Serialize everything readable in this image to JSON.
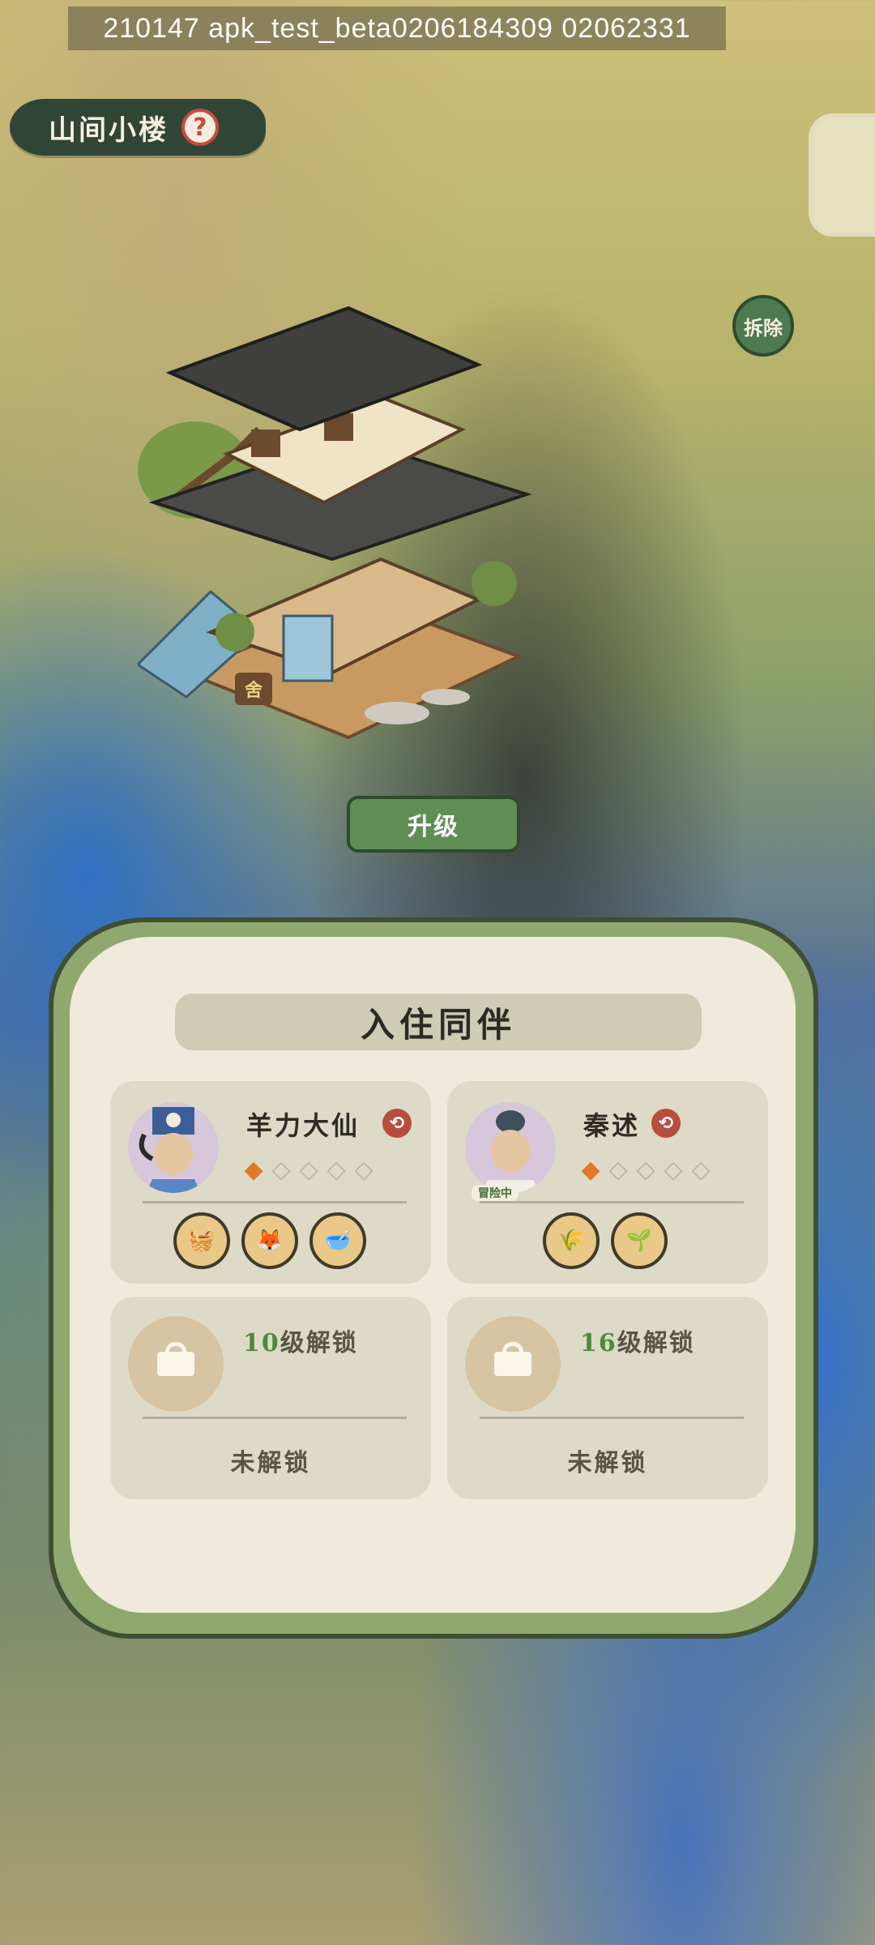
{
  "debug_banner": "210147  apk_test_beta0206184309  02062331",
  "header": {
    "title": "山间小楼",
    "help_icon": "question-mark-icon"
  },
  "actions": {
    "demolish_label": "拆除",
    "upgrade_label": "升级"
  },
  "building": {
    "sign_char": "舍"
  },
  "panel": {
    "title": "入住同伴",
    "residents": [
      {
        "name": "羊力大仙",
        "stars_filled": 1,
        "stars_total": 5,
        "swap_icon": "swap-icon",
        "skill_icons": [
          "basket-icon",
          "fox-icon",
          "bowl-icon"
        ]
      },
      {
        "name": "秦述",
        "status_badge": "冒险中",
        "stars_filled": 1,
        "stars_total": 5,
        "swap_icon": "swap-icon",
        "skill_icons": [
          "crop-field-icon",
          "seedling-plot-icon"
        ]
      }
    ],
    "locked_slots": [
      {
        "level": "10",
        "requirement_suffix": "级解锁",
        "state": "未解锁"
      },
      {
        "level": "16",
        "requirement_suffix": "级解锁",
        "state": "未解锁"
      }
    ]
  },
  "colors": {
    "accent_green": "#5f8e55",
    "star_active": "#e07a2a",
    "swap_red": "#b84c3d"
  }
}
